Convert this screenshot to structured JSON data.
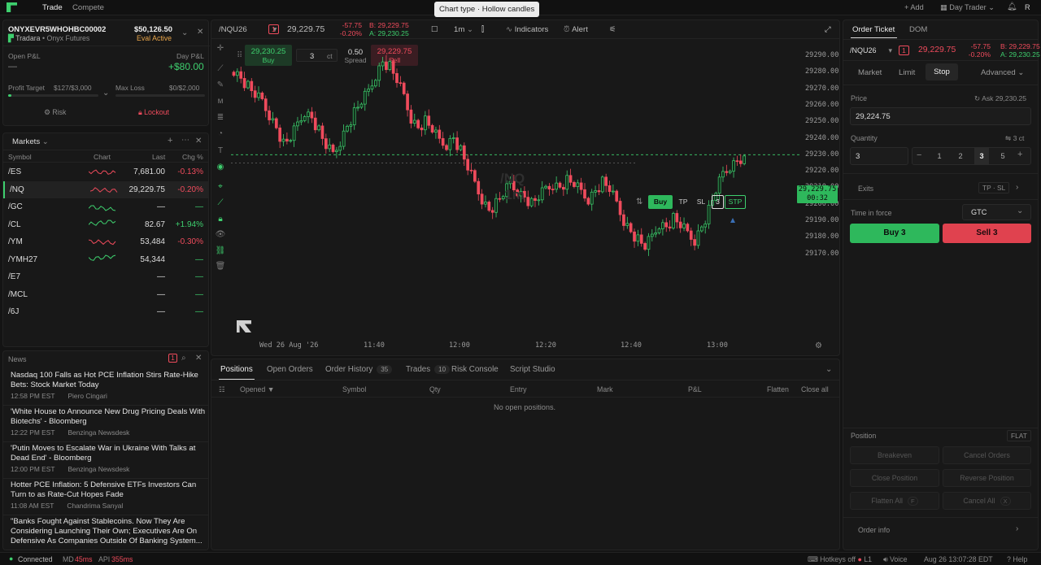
{
  "top": {
    "tabs": [
      "Trade",
      "Compete"
    ],
    "add": "+ Add",
    "layout": "Day Trader",
    "avatar": "R",
    "tooltip": "Chart type · Hollow candles"
  },
  "account": {
    "id": "ONYXEVR5WHOHBC00002",
    "firm": "Tradara",
    "sub": "• Onyx Futures",
    "balance": "$50,126.50",
    "eval": "Eval",
    "status": "Active",
    "open_pnl_label": "Open P&L",
    "open_pnl": "—",
    "day_pnl_label": "Day P&L",
    "day_pnl": "+$80.00",
    "pt_label": "Profit Target",
    "pt_val": "$127/$3,000",
    "ml_label": "Max Loss",
    "ml_val": "$0/$2,000",
    "profit_target_progress": 0.04,
    "risk": "Risk",
    "lockout": "Lockout"
  },
  "markets": {
    "title": "Markets",
    "cols": [
      "Symbol",
      "Chart",
      "Last",
      "Chg %"
    ],
    "rows": [
      {
        "sym": "/ES",
        "last": "7,681.00",
        "chg": "-0.13%",
        "dir": "neg"
      },
      {
        "sym": "/NQ",
        "last": "29,229.75",
        "chg": "-0.20%",
        "dir": "neg"
      },
      {
        "sym": "/GC",
        "last": "—",
        "chg": "—",
        "dir": "pos"
      },
      {
        "sym": "/CL",
        "last": "82.67",
        "chg": "+1.94%",
        "dir": "pos"
      },
      {
        "sym": "/YM",
        "last": "53,484",
        "chg": "-0.30%",
        "dir": "neg"
      },
      {
        "sym": "/YMH27",
        "last": "54,344",
        "chg": "—",
        "dir": "pos"
      },
      {
        "sym": "/E7",
        "last": "—",
        "chg": "—",
        "dir": "pos"
      },
      {
        "sym": "/MCL",
        "last": "—",
        "chg": "—",
        "dir": "pos"
      },
      {
        "sym": "/6J",
        "last": "—",
        "chg": "—",
        "dir": "pos"
      }
    ]
  },
  "news": {
    "title": "News",
    "count": "1",
    "items": [
      {
        "t": "Nasdaq 100 Falls as Hot PCE Inflation Stirs Rate-Hike Bets: Stock Market Today",
        "time": "12:58 PM EST",
        "src": "Piero Cingari"
      },
      {
        "t": "'White House to Announce New Drug Pricing Deals With Biotechs' - Bloomberg",
        "time": "12:22 PM EST",
        "src": "Benzinga Newsdesk"
      },
      {
        "t": "'Putin Moves to Escalate War in Ukraine With Talks at Dead End' - Bloomberg",
        "time": "12:00 PM EST",
        "src": "Benzinga Newsdesk"
      },
      {
        "t": "Hotter PCE Inflation: 5 Defensive ETFs Investors Can Turn to as Rate-Cut Hopes Fade",
        "time": "11:08 AM EST",
        "src": "Chandrima Sanyal"
      },
      {
        "t": "\"Banks Fought Against Stablecoins. Now They Are Considering Launching Their Own; Executives Are On Defensive As Companies Outside Of Banking System...",
        "time": "",
        "src": ""
      }
    ]
  },
  "chart_toolbar": {
    "symbol": "/NQU26",
    "qty_badge": "1",
    "price": "29,229.75",
    "chg": "-57.75",
    "chgp": "-0.20%",
    "bid": "B: 29,229.75",
    "ask": "A: 29,230.25",
    "tf": "1m",
    "indicators": "Indicators",
    "alert": "Alert"
  },
  "quick": {
    "buy_price": "29,230.25",
    "buy": "Buy",
    "qty": "3",
    "unit": "ct",
    "spread": "0.50",
    "spread_label": "Spread",
    "sell_price": "29,229.75",
    "sell": "Sell"
  },
  "chart": {
    "watermark_sym": "/NQ",
    "watermark_tf": "1m",
    "date": "Wed 26 Aug '26",
    "xticks": [
      "11:40",
      "12:00",
      "12:20",
      "12:40",
      "13:00"
    ],
    "yticks": [
      "29290.00",
      "29280.00",
      "29270.00",
      "29260.00",
      "29250.00",
      "29240.00",
      "29230.00",
      "29220.00",
      "29210.00",
      "29200.00",
      "29190.00",
      "29180.00",
      "29170.00"
    ],
    "last_price": "29,229.75",
    "timer": "00:32",
    "order_buy": "Buy",
    "tp": "TP",
    "sl": "SL",
    "order_qty": "3",
    "stp": "STP"
  },
  "positions": {
    "tabs": [
      {
        "l": "Positions"
      },
      {
        "l": "Open Orders"
      },
      {
        "l": "Order History",
        "b": "35"
      },
      {
        "l": "Trades",
        "b": "10"
      },
      {
        "l": "Risk Console"
      },
      {
        "l": "Script Studio"
      }
    ],
    "cols": [
      "Opened ▼",
      "Symbol",
      "Qty",
      "Entry",
      "Mark",
      "P&L",
      "Flatten",
      "Close all"
    ],
    "empty": "No open positions."
  },
  "ticket": {
    "tabs": [
      "Order Ticket",
      "DOM"
    ],
    "symbol": "/NQU26",
    "qty_badge": "1",
    "price": "29,229.75",
    "chg": "-57.75",
    "chgp": "-0.20%",
    "bid": "B: 29,229.75",
    "ask": "A: 29,230.25",
    "types": [
      "Market",
      "Limit",
      "Stop"
    ],
    "advanced": "Advanced",
    "price_label": "Price",
    "ask_ref": "Ask 29,230.25",
    "price_val": "29,224.75",
    "qty_label": "Quantity",
    "qty_ct": "3 ct",
    "qty_val": "3",
    "presets": [
      "1",
      "2",
      "3",
      "5"
    ],
    "exits": "Exits",
    "tpsl": "TP · SL",
    "tif_label": "Time in force",
    "tif": "GTC",
    "buy": "Buy 3",
    "sell": "Sell 3",
    "position": "Position",
    "flat": "FLAT",
    "actions": [
      "Breakeven",
      "Cancel Orders",
      "Close Position",
      "Reverse Position",
      "Flatten All",
      "Cancel All"
    ],
    "hk1": "F",
    "hk2": "X",
    "order_info": "Order info"
  },
  "status": {
    "connected": "Connected",
    "md": "MD",
    "md_v": "45ms",
    "api": "API",
    "api_v": "355ms",
    "hotkeys": "Hotkeys off",
    "l1": "L1",
    "voice": "Voice",
    "time": "Aug 26 13:07:28 EDT",
    "help": "Help"
  },
  "colors": {
    "up": "#3ecf6e",
    "down": "#ef4b5c",
    "bg": "#141414"
  },
  "candle_seed": [
    29281,
    29276,
    29271,
    29266,
    29262,
    29254,
    29246,
    29236,
    29240,
    29248,
    29256,
    29252,
    29244,
    29235,
    29230,
    29238,
    29247,
    29255,
    29262,
    29268,
    29278,
    29286,
    29283,
    29275,
    29265,
    29252,
    29246,
    29250,
    29245,
    29238,
    29236,
    29240,
    29232,
    29222,
    29212,
    29203,
    29196,
    29200,
    29206,
    29212,
    29208,
    29204,
    29200,
    29204,
    29209,
    29212,
    29210,
    29214,
    29212,
    29207,
    29203,
    29208,
    29213,
    29209,
    29200,
    29190,
    29183,
    29178,
    29174,
    29180,
    29188,
    29186,
    29191,
    29187,
    29182,
    29178,
    29186,
    29196,
    29208,
    29218,
    29223,
    29226,
    29229
  ]
}
